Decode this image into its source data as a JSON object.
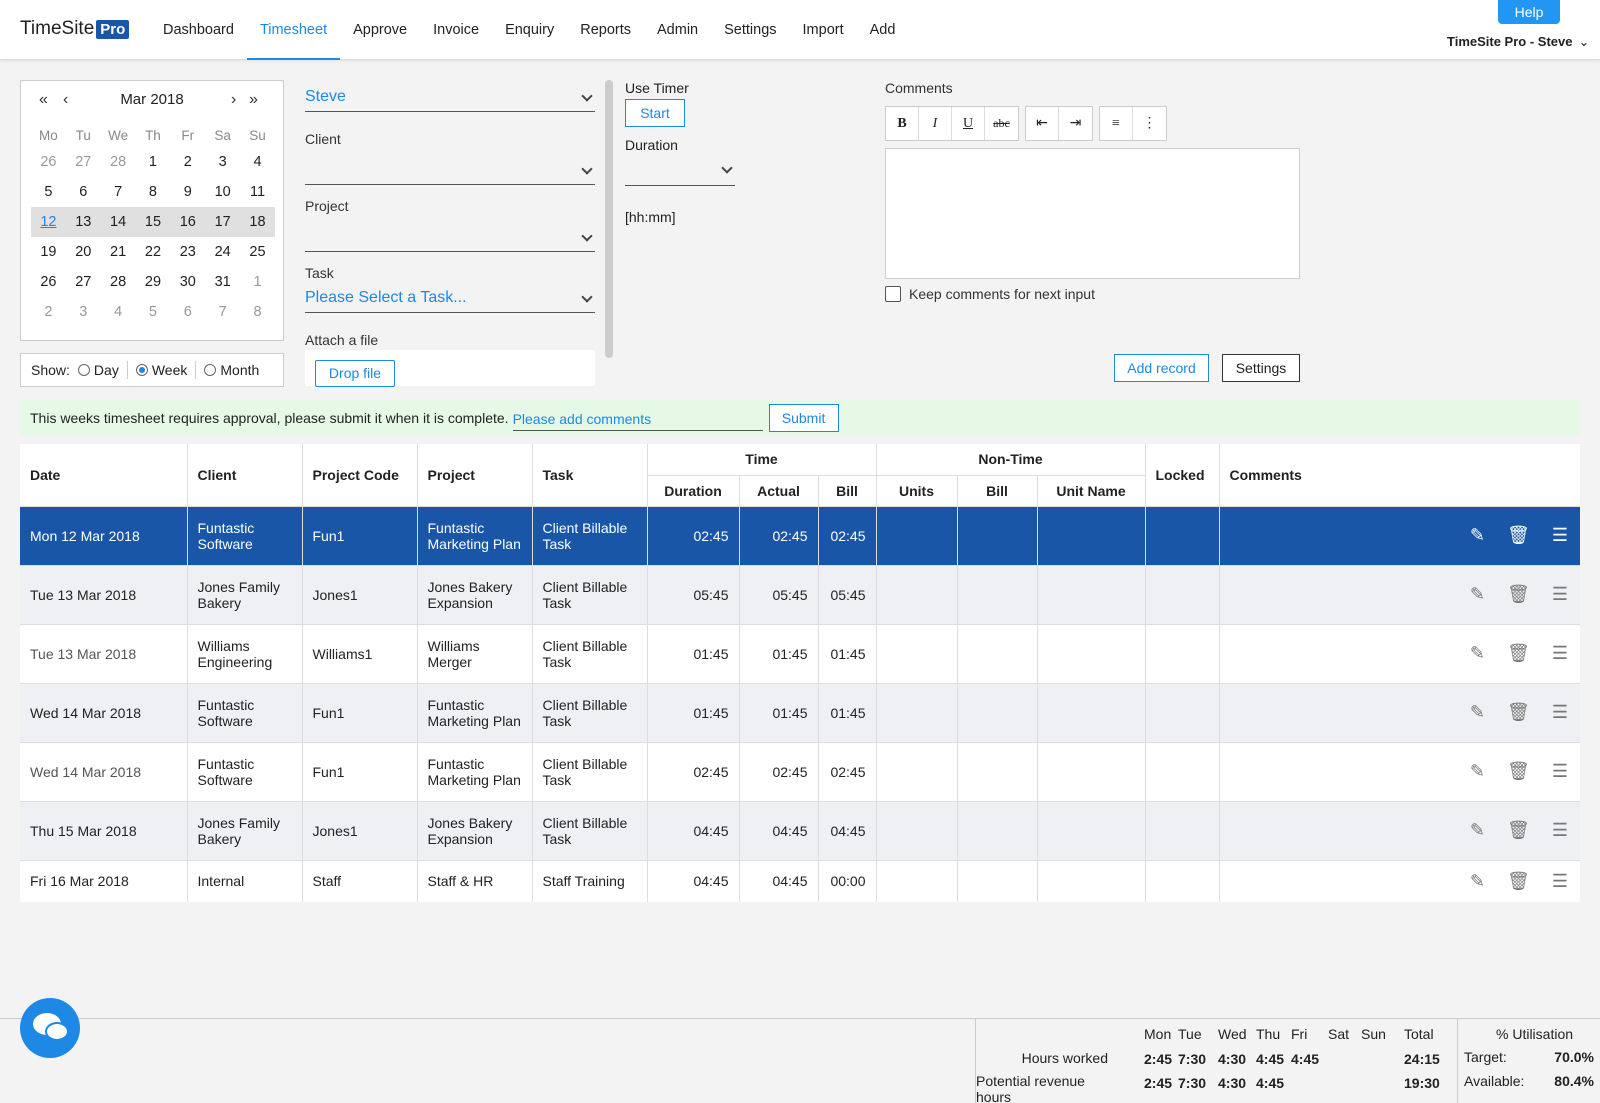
{
  "app": {
    "logo_text": "TimeSite",
    "logo_badge": "Pro",
    "help": "Help",
    "user": "TimeSite Pro - Steve"
  },
  "nav": [
    "Dashboard",
    "Timesheet",
    "Approve",
    "Invoice",
    "Enquiry",
    "Reports",
    "Admin",
    "Settings",
    "Import",
    "Add"
  ],
  "nav_active": "Timesheet",
  "calendar": {
    "title": "Mar 2018",
    "weekdays": [
      "Mo",
      "Tu",
      "We",
      "Th",
      "Fr",
      "Sa",
      "Su"
    ],
    "weeks": [
      [
        "26",
        "27",
        "28",
        "1",
        "2",
        "3",
        "4"
      ],
      [
        "5",
        "6",
        "7",
        "8",
        "9",
        "10",
        "11"
      ],
      [
        "12",
        "13",
        "14",
        "15",
        "16",
        "17",
        "18"
      ],
      [
        "19",
        "20",
        "21",
        "22",
        "23",
        "24",
        "25"
      ],
      [
        "26",
        "27",
        "28",
        "29",
        "30",
        "31",
        "1"
      ],
      [
        "2",
        "3",
        "4",
        "5",
        "6",
        "7",
        "8"
      ]
    ]
  },
  "show": {
    "label": "Show:",
    "options": [
      "Day",
      "Week",
      "Month"
    ],
    "selected": "Week"
  },
  "form": {
    "user": "Steve",
    "client_label": "Client",
    "client": "",
    "project_label": "Project",
    "project": "",
    "task_label": "Task",
    "task": "Please Select a Task...",
    "attach_label": "Attach a file",
    "drop": "Drop file"
  },
  "timer": {
    "label": "Use Timer",
    "start": "Start",
    "duration_label": "Duration",
    "format": "[hh:mm]"
  },
  "comments": {
    "label": "Comments",
    "keep": "Keep comments for next input"
  },
  "toolbar": [
    "B",
    "I",
    "U",
    "abc",
    "outdent",
    "indent",
    "ordered-list",
    "bullet-list"
  ],
  "buttons": {
    "add_record": "Add record",
    "settings": "Settings"
  },
  "banner": {
    "text": "This weeks timesheet requires approval, please submit it when it is complete.",
    "comment_placeholder": "Please add comments",
    "submit": "Submit"
  },
  "table": {
    "headers": {
      "date": "Date",
      "client": "Client",
      "project_code": "Project Code",
      "project": "Project",
      "task": "Task",
      "time": "Time",
      "duration": "Duration",
      "actual": "Actual",
      "bill": "Bill",
      "non_time": "Non-Time",
      "units": "Units",
      "nt_bill": "Bill",
      "unit_name": "Unit Name",
      "locked": "Locked",
      "comments": "Comments"
    },
    "rows": [
      {
        "date": "Mon 12 Mar 2018",
        "client": "Funtastic Software",
        "code": "Fun1",
        "project": "Funtastic Marketing Plan",
        "task": "Client Billable Task",
        "duration": "02:45",
        "actual": "02:45",
        "bill": "02:45"
      },
      {
        "date": "Tue 13 Mar 2018",
        "client": "Jones Family Bakery",
        "code": "Jones1",
        "project": "Jones Bakery Expansion",
        "task": "Client Billable Task",
        "duration": "05:45",
        "actual": "05:45",
        "bill": "05:45"
      },
      {
        "date": "Tue 13 Mar 2018",
        "client": "Williams Engineering",
        "code": "Williams1",
        "project": "Williams Merger",
        "task": "Client Billable Task",
        "duration": "01:45",
        "actual": "01:45",
        "bill": "01:45"
      },
      {
        "date": "Wed 14 Mar 2018",
        "client": "Funtastic Software",
        "code": "Fun1",
        "project": "Funtastic Marketing Plan",
        "task": "Client Billable Task",
        "duration": "01:45",
        "actual": "01:45",
        "bill": "01:45"
      },
      {
        "date": "Wed 14 Mar 2018",
        "client": "Funtastic Software",
        "code": "Fun1",
        "project": "Funtastic Marketing Plan",
        "task": "Client Billable Task",
        "duration": "02:45",
        "actual": "02:45",
        "bill": "02:45"
      },
      {
        "date": "Thu 15 Mar 2018",
        "client": "Jones Family Bakery",
        "code": "Jones1",
        "project": "Jones Bakery Expansion",
        "task": "Client Billable Task",
        "duration": "04:45",
        "actual": "04:45",
        "bill": "04:45"
      },
      {
        "date": "Fri 16 Mar 2018",
        "client": "Internal",
        "code": "Staff",
        "project": "Staff & HR",
        "task": "Staff Training",
        "duration": "04:45",
        "actual": "04:45",
        "bill": "00:00"
      }
    ]
  },
  "summary": {
    "days": [
      "Mon",
      "Tue",
      "Wed",
      "Thu",
      "Fri",
      "Sat",
      "Sun",
      "Total"
    ],
    "hours_label": "Hours worked",
    "hours": [
      "2:45",
      "7:30",
      "4:30",
      "4:45",
      "4:45",
      "",
      "",
      "24:15"
    ],
    "revenue_label": "Potential revenue hours",
    "revenue": [
      "2:45",
      "7:30",
      "4:30",
      "4:45",
      "",
      "",
      "",
      "19:30"
    ],
    "util_title": "% Utilisation",
    "target_label": "Target:",
    "target": "70.0%",
    "available_label": "Available:",
    "available": "80.4%"
  },
  "colors": {
    "accent": "#1e88e5",
    "brand": "#1a56a8",
    "banner": "#e6f8e6"
  }
}
